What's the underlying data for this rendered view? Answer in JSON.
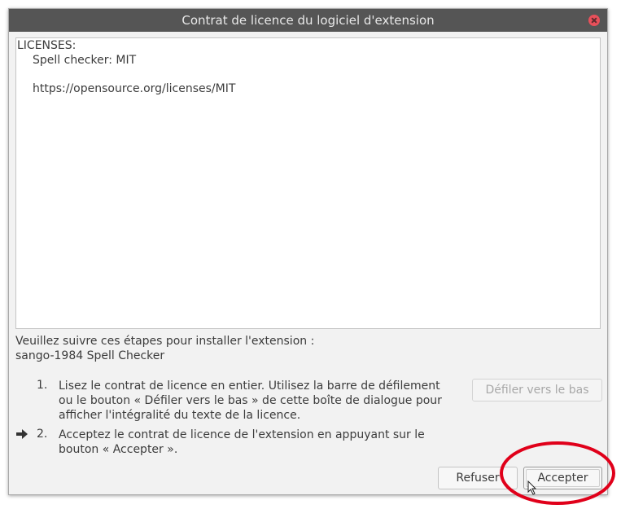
{
  "window": {
    "title": "Contrat de licence du logiciel d'extension"
  },
  "license": {
    "lines": [
      "LICENSES:",
      "Spell checker: MIT",
      "https://opensource.org/licenses/MIT"
    ]
  },
  "intro": {
    "line1": "Veuillez suivre ces étapes pour installer l'extension :",
    "line2": "sango-1984 Spell Checker"
  },
  "steps": [
    {
      "number": "1.",
      "text": "Lisez le contrat de licence en entier. Utilisez la barre de défilement ou le bouton « Défiler vers le bas » de cette boîte de dialogue pour afficher l'intégralité du texte de la licence."
    },
    {
      "number": "2.",
      "text": "Acceptez le contrat de licence de l'extension en appuyant sur le bouton « Accepter »."
    }
  ],
  "buttons": {
    "scroll_down": "Défiler vers le bas",
    "refuse": "Refuser",
    "accept": "Accepter"
  },
  "icons": {
    "close": "close-icon",
    "current_step": "arrow-right-icon",
    "cursor": "mouse-cursor-icon"
  },
  "colors": {
    "titlebar": "#555555",
    "close": "#e8505a",
    "highlight": "#e0001a"
  }
}
